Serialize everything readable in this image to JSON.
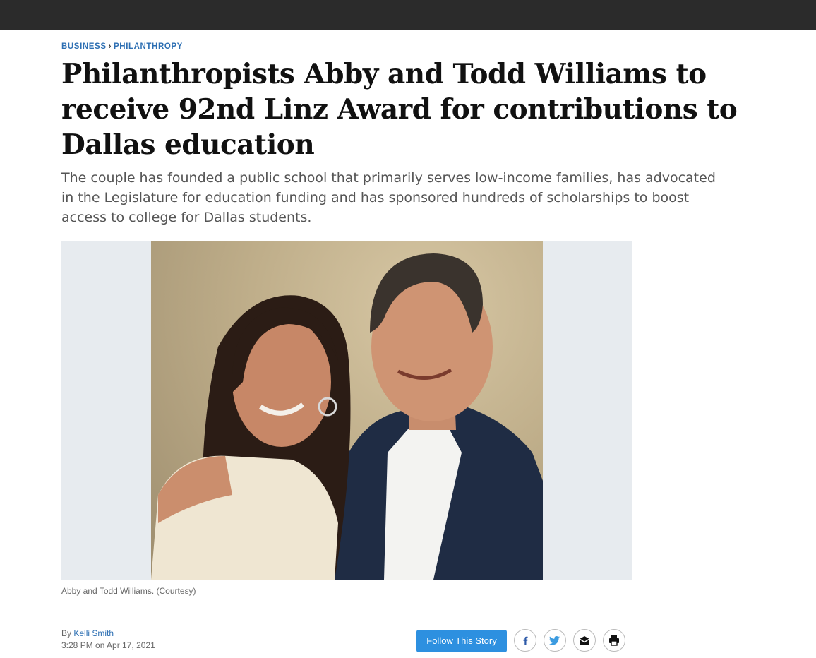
{
  "breadcrumb": {
    "section": "BUSINESS",
    "separator": "›",
    "subsection": "PHILANTHROPY"
  },
  "article": {
    "headline": "Philanthropists Abby and Todd Williams to receive 92nd Linz Award for contributions to Dallas education",
    "dek": "The couple has founded a public school that primarily serves low-income families, has advocated in the Legislature for education funding and has sponsored hundreds of scholarships to boost access to college for Dallas students.",
    "caption": "Abby and Todd Williams. (Courtesy)",
    "byline_prefix": "By",
    "author": "Kelli Smith",
    "timestamp": "3:28 PM on Apr 17, 2021"
  },
  "actions": {
    "follow_label": "Follow This Story"
  },
  "share_icons": [
    "facebook-icon",
    "twitter-icon",
    "email-icon",
    "print-icon"
  ],
  "colors": {
    "topbar": "#2b2b2b",
    "link_blue": "#2d6fb3",
    "follow_button": "#2d90e0",
    "photo_backdrop": "#e7ebef"
  }
}
